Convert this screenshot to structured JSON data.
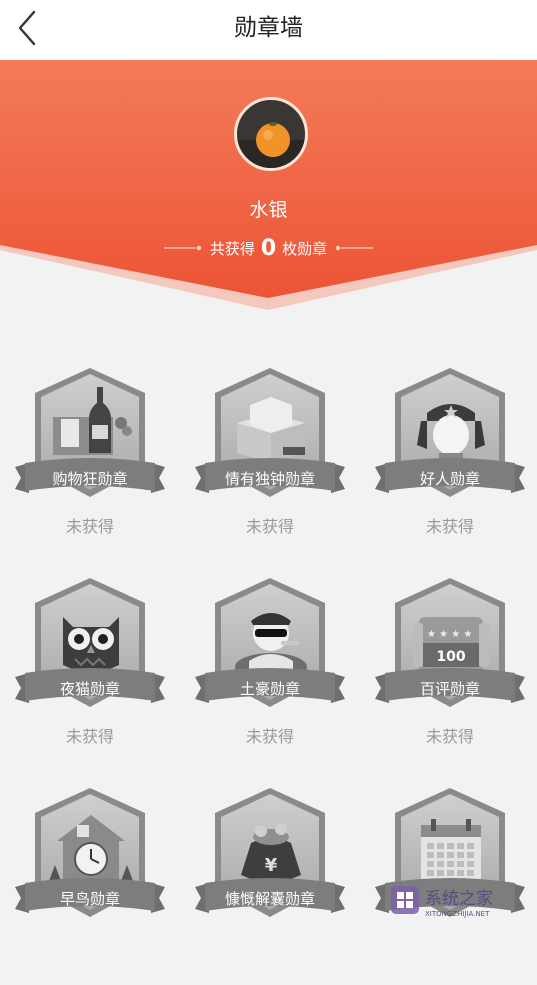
{
  "header": {
    "title": "勋章墙",
    "back_icon": "chevron-left-icon"
  },
  "profile": {
    "username": "水银",
    "count_prefix": "共获得",
    "count_value": "0",
    "count_suffix": "枚勋章",
    "accent_color": "#ee5f3c"
  },
  "badges": [
    {
      "name": "购物狂勋章",
      "status": "未获得",
      "icon": "shopping-bottle-icon"
    },
    {
      "name": "情有独钟勋章",
      "status": "未获得",
      "icon": "gift-box-icon"
    },
    {
      "name": "好人勋章",
      "status": "未获得",
      "icon": "soldier-hat-icon"
    },
    {
      "name": "夜猫勋章",
      "status": "未获得",
      "icon": "owl-icon"
    },
    {
      "name": "土豪勋章",
      "status": "未获得",
      "icon": "rich-man-icon"
    },
    {
      "name": "百评勋章",
      "status": "未获得",
      "icon": "rating-card-icon"
    },
    {
      "name": "早鸟勋章",
      "status": "",
      "icon": "clock-house-icon"
    },
    {
      "name": "慷慨解囊勋章",
      "status": "",
      "icon": "money-bag-icon"
    },
    {
      "name": "",
      "status": "",
      "icon": "calendar-icon"
    }
  ],
  "badge_card_100_text": "100",
  "watermark": {
    "line1": "系统之家",
    "line2": "XITONGZHIJIA.NET"
  }
}
